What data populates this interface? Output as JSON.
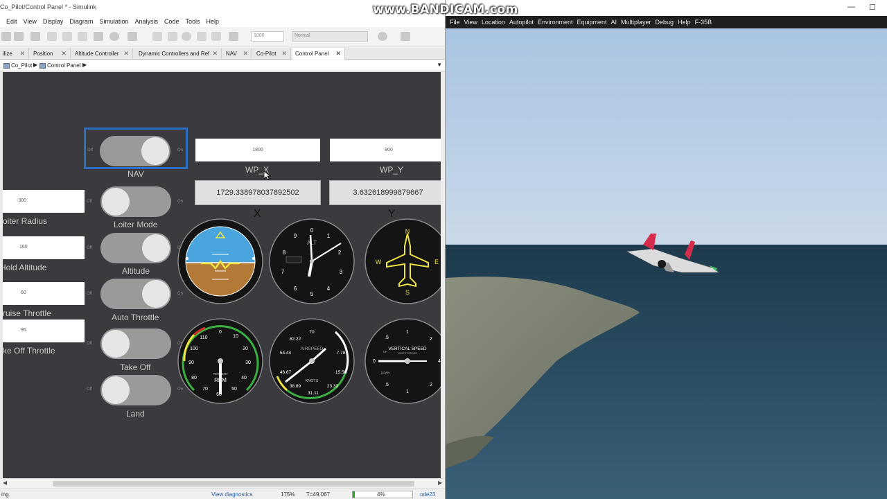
{
  "watermark": "www.BANDICAM.com",
  "simulink": {
    "title": "Co_Pilot/Control Panel * - Simulink",
    "menu": [
      "Edit",
      "View",
      "Display",
      "Diagram",
      "Simulation",
      "Analysis",
      "Code",
      "Tools",
      "Help"
    ],
    "toolbar": {
      "stop_time": "1000",
      "sim_mode": "Normal"
    },
    "tabs": [
      {
        "label": "ilize"
      },
      {
        "label": "Position"
      },
      {
        "label": "Altitude Controller"
      },
      {
        "label": "Dynamic Controllers and Ref"
      },
      {
        "label": "NAV"
      },
      {
        "label": "Co-Pilot"
      },
      {
        "label": "Control Panel"
      }
    ],
    "breadcrumb": [
      "Co_Pilot",
      "Control Panel"
    ],
    "panel": {
      "inputs": {
        "wp_x": "1800",
        "wp_y": "900",
        "loiter_radius": "-300",
        "hold_altitude": "160",
        "cruise_throttle": "60",
        "takeoff_throttle": "95"
      },
      "labels": {
        "wp_x": "WP_X",
        "wp_y": "WP_Y",
        "loiter_radius": "oiter Radius",
        "hold_altitude": "Hold Altitude",
        "cruise_throttle": "ruise Throttle",
        "takeoff_throttle": "ke Off Throttle",
        "x": "X",
        "y": "Y"
      },
      "displays": {
        "x_value": "1729.338978037892502",
        "y_value": "3.632618999879667"
      },
      "toggles": {
        "nav": {
          "label": "NAV",
          "state": "on"
        },
        "loiter_mode": {
          "label": "Loiter Mode",
          "state": "off"
        },
        "altitude": {
          "label": "Altitude",
          "state": "on"
        },
        "auto_throttle": {
          "label": "Auto Throttle",
          "state": "on"
        },
        "take_off": {
          "label": "Take Off",
          "state": "off"
        },
        "land": {
          "label": "Land",
          "state": "off"
        }
      },
      "switch_off": "Off",
      "switch_on": "On",
      "gauges": {
        "altimeter": {
          "label": "ALT"
        },
        "airspeed": {
          "label": "AIRSPEED",
          "unit": "KNOTS",
          "ticks": [
            "70",
            "7.78",
            "15.56",
            "23.33",
            "31.11",
            "38.89",
            "46.67",
            "54.44",
            "62.22"
          ]
        },
        "rpm": {
          "label": "RPM",
          "sub": "PERCENT",
          "ticks": [
            "0",
            "10",
            "20",
            "30",
            "40",
            "50",
            "60",
            "70",
            "80",
            "90",
            "100",
            "110"
          ]
        },
        "vsi": {
          "label": "VERTICAL SPEED",
          "sub": "1000FT PER MIN",
          "up": "UP",
          "down": "DOWN",
          "ticks": [
            "0",
            ".5",
            "1",
            "2",
            "4",
            "2",
            "1",
            ".5"
          ]
        },
        "heading": {
          "ticks": [
            "N",
            "E",
            "S",
            "W"
          ]
        }
      }
    },
    "status": {
      "left": "ing",
      "diagnostics": "View diagnostics",
      "zoom": "175%",
      "time": "T=49.067",
      "progress": "4%",
      "progress_value": 0.04,
      "solver": "ode23"
    }
  },
  "flightgear": {
    "menu": [
      "File",
      "View",
      "Location",
      "Autopilot",
      "Environment",
      "Equipment",
      "AI",
      "Multiplayer",
      "Debug",
      "Help",
      "F-35B"
    ],
    "window_controls": {
      "minimize": "—",
      "maximize": "☐"
    }
  }
}
